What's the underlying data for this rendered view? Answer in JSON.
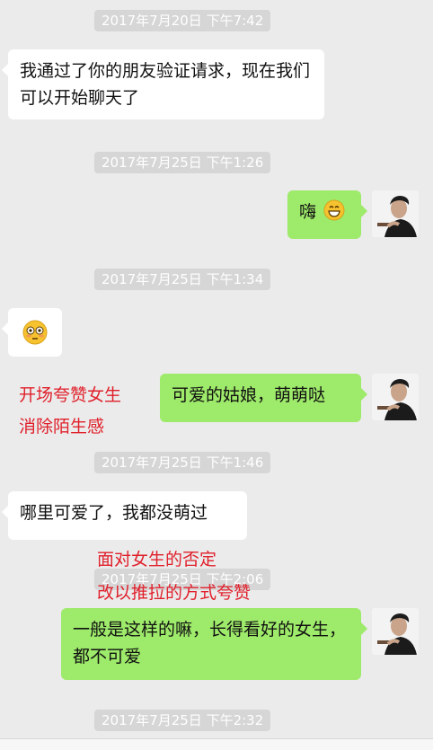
{
  "timestamps": [
    "2017年7月20日 下午7:42",
    "2017年7月25日 下午1:26",
    "2017年7月25日 下午1:34",
    "2017年7月25日 下午1:46",
    "2017年7月25日 下午2:06",
    "2017年7月25日 下午2:32"
  ],
  "messages": {
    "system_add": "我通过了你的朋友验证请求，现在我们可以开始聊天了",
    "hi": "嗨",
    "hi_emoji": "grinning-face-icon",
    "reply_emoji": "flushed-face-icon",
    "compliment": "可爱的姑娘，萌萌哒",
    "deny": "哪里可爱了，我都没萌过",
    "pushpull": "一般是这样的嘛，长得看好的女生，都不可爱"
  },
  "annotations": {
    "a1_line1": "开场夸赞女生",
    "a1_line2": "消除陌生感",
    "a2_line1": "面对女生的否定",
    "a2_line2": "改以推拉的方式夸赞"
  },
  "colors": {
    "background": "#ebebeb",
    "bubble_out": "#9eea6a",
    "bubble_in": "#ffffff",
    "annotation": "#e0202b",
    "timestamp_bg": "#d6d6d6"
  }
}
